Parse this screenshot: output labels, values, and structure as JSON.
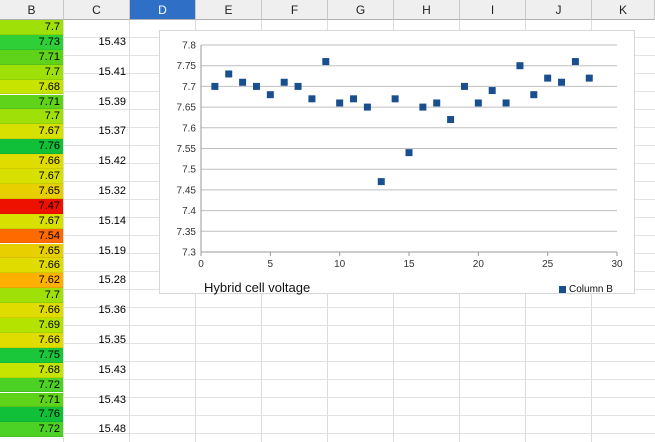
{
  "columns": [
    "B",
    "C",
    "D",
    "E",
    "F",
    "G",
    "H",
    "I",
    "J",
    "K"
  ],
  "active_column": "D",
  "column_b_values": [
    "7.7",
    "7.73",
    "7.71",
    "7.7",
    "7.68",
    "7.71",
    "7.7",
    "7.67",
    "7.76",
    "7.66",
    "7.67",
    "7.65",
    "7.47",
    "7.67",
    "7.54",
    "7.65",
    "7.66",
    "7.62",
    "7.7",
    "7.66",
    "7.69",
    "7.66",
    "7.75",
    "7.68",
    "7.72",
    "7.71",
    "7.76",
    "7.72"
  ],
  "column_b_colors": [
    "#9ee007",
    "#2ecf37",
    "#5fd21a",
    "#9ee007",
    "#c7e400",
    "#5fd21a",
    "#9ee007",
    "#d8e000",
    "#10c038",
    "#e0dc00",
    "#d8e000",
    "#e8cf00",
    "#ee1100",
    "#d8e000",
    "#ff6a00",
    "#e8cf00",
    "#e0dc00",
    "#ffb000",
    "#9ee007",
    "#e0dc00",
    "#b5e300",
    "#e0dc00",
    "#1ac73b",
    "#c7e400",
    "#4bd225",
    "#5fd21a",
    "#10c038",
    "#4bd225"
  ],
  "column_c_values": [
    "",
    "15.43",
    "",
    "15.41",
    "",
    "15.39",
    "",
    "15.37",
    "",
    "15.42",
    "",
    "15.32",
    "",
    "15.14",
    "",
    "15.19",
    "",
    "15.28",
    "",
    "15.36",
    "",
    "15.35",
    "",
    "15.43",
    "",
    "15.43",
    "",
    "15.48"
  ],
  "chart_data": {
    "type": "scatter",
    "title": "Hybrid cell voltage",
    "xlim": [
      0,
      30
    ],
    "ylim": [
      7.3,
      7.8
    ],
    "x_ticks": [
      "0",
      "5",
      "10",
      "15",
      "20",
      "25",
      "30"
    ],
    "y_ticks": [
      "7.8",
      "7.75",
      "7.7",
      "7.65",
      "7.6",
      "7.55",
      "7.5",
      "7.45",
      "7.4",
      "7.35",
      "7.3"
    ],
    "grid": true,
    "legend_position": "bottom-right",
    "series": [
      {
        "name": "Column B",
        "color": "#1a4f8f",
        "x": [
          1,
          2,
          3,
          4,
          5,
          6,
          7,
          8,
          9,
          10,
          11,
          12,
          13,
          14,
          15,
          16,
          17,
          18,
          19,
          20,
          21,
          22,
          23,
          24,
          25,
          26,
          27,
          28
        ],
        "y": [
          7.7,
          7.73,
          7.71,
          7.7,
          7.68,
          7.71,
          7.7,
          7.67,
          7.76,
          7.66,
          7.67,
          7.65,
          7.47,
          7.67,
          7.54,
          7.65,
          7.66,
          7.62,
          7.7,
          7.66,
          7.69,
          7.66,
          7.75,
          7.68,
          7.72,
          7.71,
          7.76,
          7.72
        ]
      }
    ]
  }
}
